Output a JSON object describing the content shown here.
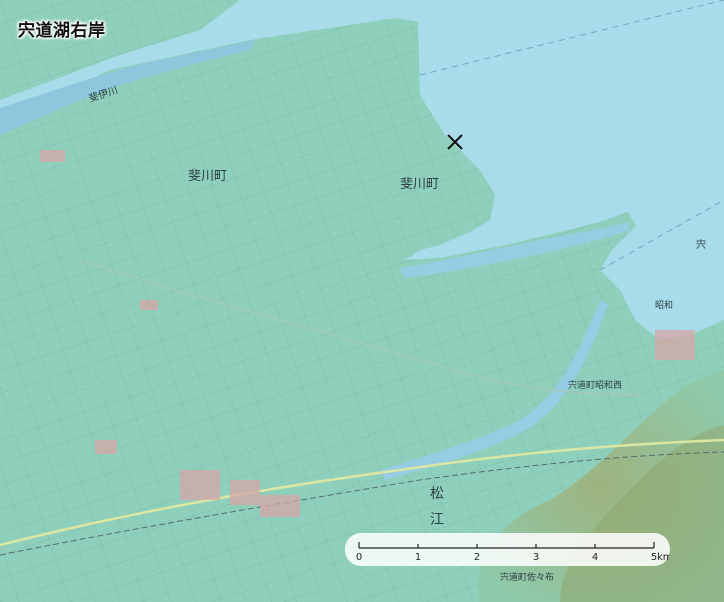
{
  "title": "宍道湖右岸",
  "colors": {
    "lake": "#a8dcea",
    "land": "#8fd0bc",
    "river": "#8ec6dd",
    "hill": "#8fa66e",
    "marker": "#111111"
  },
  "marker": {
    "icon": "x-mark-icon"
  },
  "scale_bar": {
    "ticks": [
      "0",
      "1",
      "2",
      "3",
      "4",
      "5"
    ],
    "unit": "km"
  },
  "labels": {
    "hikawa_west": "斐川町",
    "hikawa_east": "斐川町",
    "hii_river": "斐伊川",
    "shinji": "宍",
    "matsue": "松",
    "matsue_2": "江",
    "shinji_town": "宍道町昭和西",
    "shinji_town_2": "宍道町佐々布",
    "showa": "昭和"
  }
}
